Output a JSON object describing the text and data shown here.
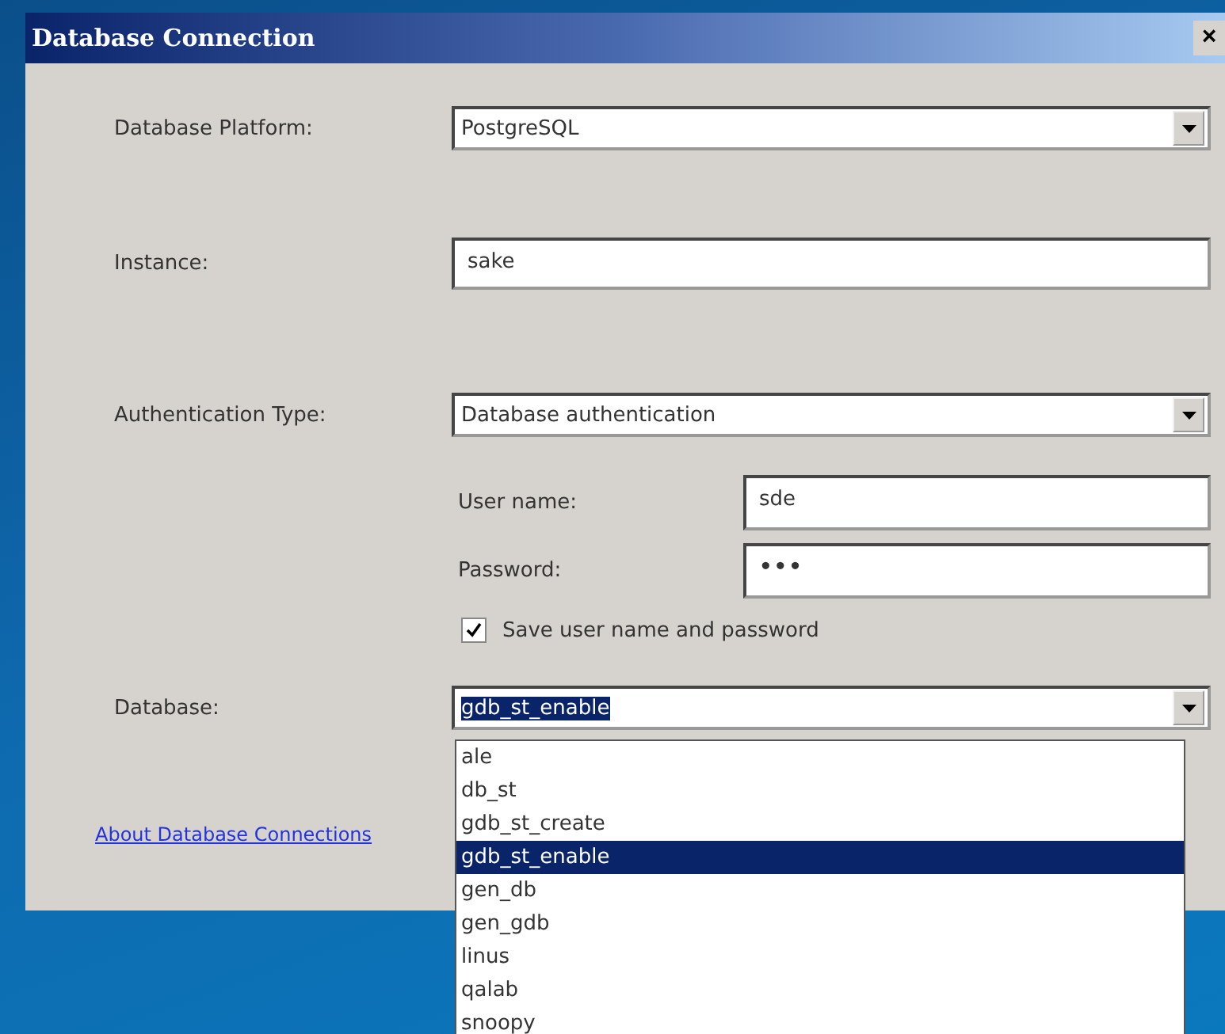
{
  "window": {
    "title": "Database Connection",
    "close": "×"
  },
  "platform": {
    "label": "Database Platform:",
    "value": "PostgreSQL"
  },
  "instance": {
    "label": "Instance:",
    "value": "sake"
  },
  "authentication": {
    "label": "Authentication Type:",
    "value": "Database authentication"
  },
  "user_name": {
    "label": "User name:",
    "value": "sde"
  },
  "password": {
    "label": "Password:",
    "value": "•••"
  },
  "save_credentials": {
    "label": "Save user name and password",
    "checked": true
  },
  "database": {
    "label": "Database:",
    "value": "gdb_st_enable",
    "expanded": true,
    "options": [
      {
        "label": "ale",
        "selected": false
      },
      {
        "label": "db_st",
        "selected": false
      },
      {
        "label": "gdb_st_create",
        "selected": false
      },
      {
        "label": "gdb_st_enable",
        "selected": true
      },
      {
        "label": "gen_db",
        "selected": false
      },
      {
        "label": "gen_gdb",
        "selected": false
      },
      {
        "label": "linus",
        "selected": false
      },
      {
        "label": "qalab",
        "selected": false
      },
      {
        "label": "snoopy",
        "selected": false
      }
    ]
  },
  "help_link": "About Database Connections"
}
